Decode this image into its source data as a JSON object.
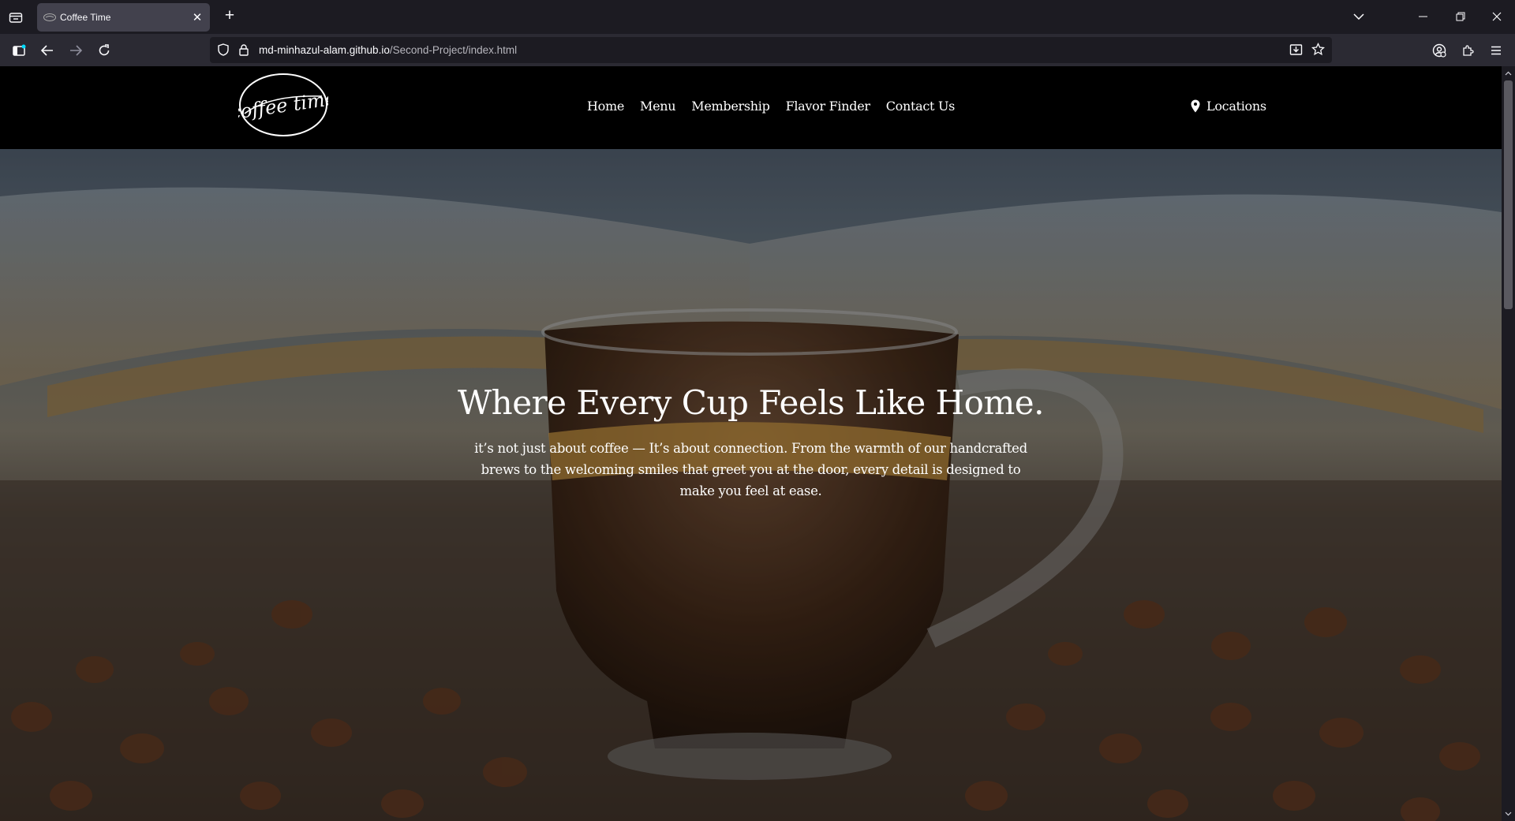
{
  "browser": {
    "tab_title": "Coffee Time",
    "url_host": "md-minhazul-alam.github.io",
    "url_path": "/Second-Project/index.html"
  },
  "site": {
    "logo_text": "coffee time",
    "nav": [
      "Home",
      "Menu",
      "Membership",
      "Flavor Finder",
      "Contact Us"
    ],
    "locations_label": "Locations"
  },
  "hero": {
    "title": "Where Every Cup Feels Like Home.",
    "subtitle": "it’s not just about coffee — It’s about connection. From the warmth of our handcrafted brews to the welcoming smiles that greet you at the door, every detail is designed to make you feel at ease."
  },
  "colors": {
    "chrome_dark": "#1c1b22",
    "chrome_toolbar": "#2b2a33",
    "tab_active": "#42414d",
    "header_bg": "#000000",
    "text_white": "#ffffff"
  }
}
